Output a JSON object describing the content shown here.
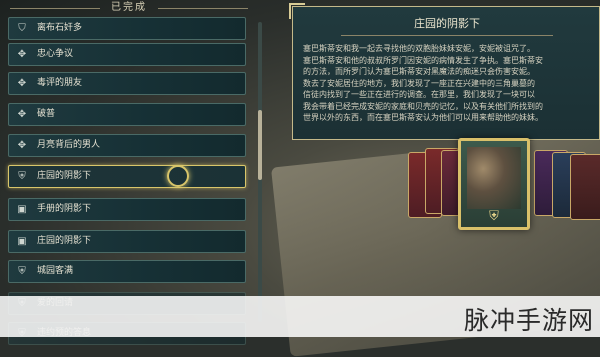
{
  "list": {
    "header": "已完成",
    "items": [
      {
        "label": "离布石奸多",
        "icon": "shield-icon"
      },
      {
        "label": "忠心争议",
        "icon": "paw-icon"
      },
      {
        "label": "毒评的朋友",
        "icon": "paw-icon"
      },
      {
        "label": "破普",
        "icon": "paw-icon"
      },
      {
        "label": "月亮背后的男人",
        "icon": "paw-icon"
      },
      {
        "label": "庄园的阴影下",
        "icon": "crest-icon"
      },
      {
        "label": "手册的阴影下",
        "icon": "book-icon"
      },
      {
        "label": "庄园的阴影下",
        "icon": "book-icon"
      },
      {
        "label": "城园客满",
        "icon": "crest-icon"
      },
      {
        "label": "爱的回请",
        "icon": "crest-icon"
      },
      {
        "label": "违约预的答息",
        "icon": "crest-icon"
      }
    ],
    "selected_index": 5
  },
  "detail": {
    "title": "庄园的阴影下",
    "body_lines": [
      "塞巴斯蒂安和我一起去寻找他的双胞胎妹妹安妮，安妮被诅咒了。",
      "塞巴斯蒂安和他的叔叔所罗门因安妮的病情发生了争执。塞巴斯蒂安",
      "的方法，而所罗门认为塞巴斯蒂安对黑魔法的痴迷只会伤害安妮。",
      "数去了安妮居住的地方，我们发现了一座正在兴建中的三角巢墓的",
      "信徒内找到了一些正在进行的调查。在那里，我们发现了一块可以",
      "我会带着已经完成安妮的家庭和贝壳的记忆，以及有关他们所找到的",
      "世界以外的东西，而在塞巴斯蒂安认为他们可以用来帮助他的妹妹。"
    ]
  },
  "watermark": "脉冲手游网",
  "colors": {
    "accent_gold": "#d9c06a",
    "panel_teal": "#1b3034"
  }
}
